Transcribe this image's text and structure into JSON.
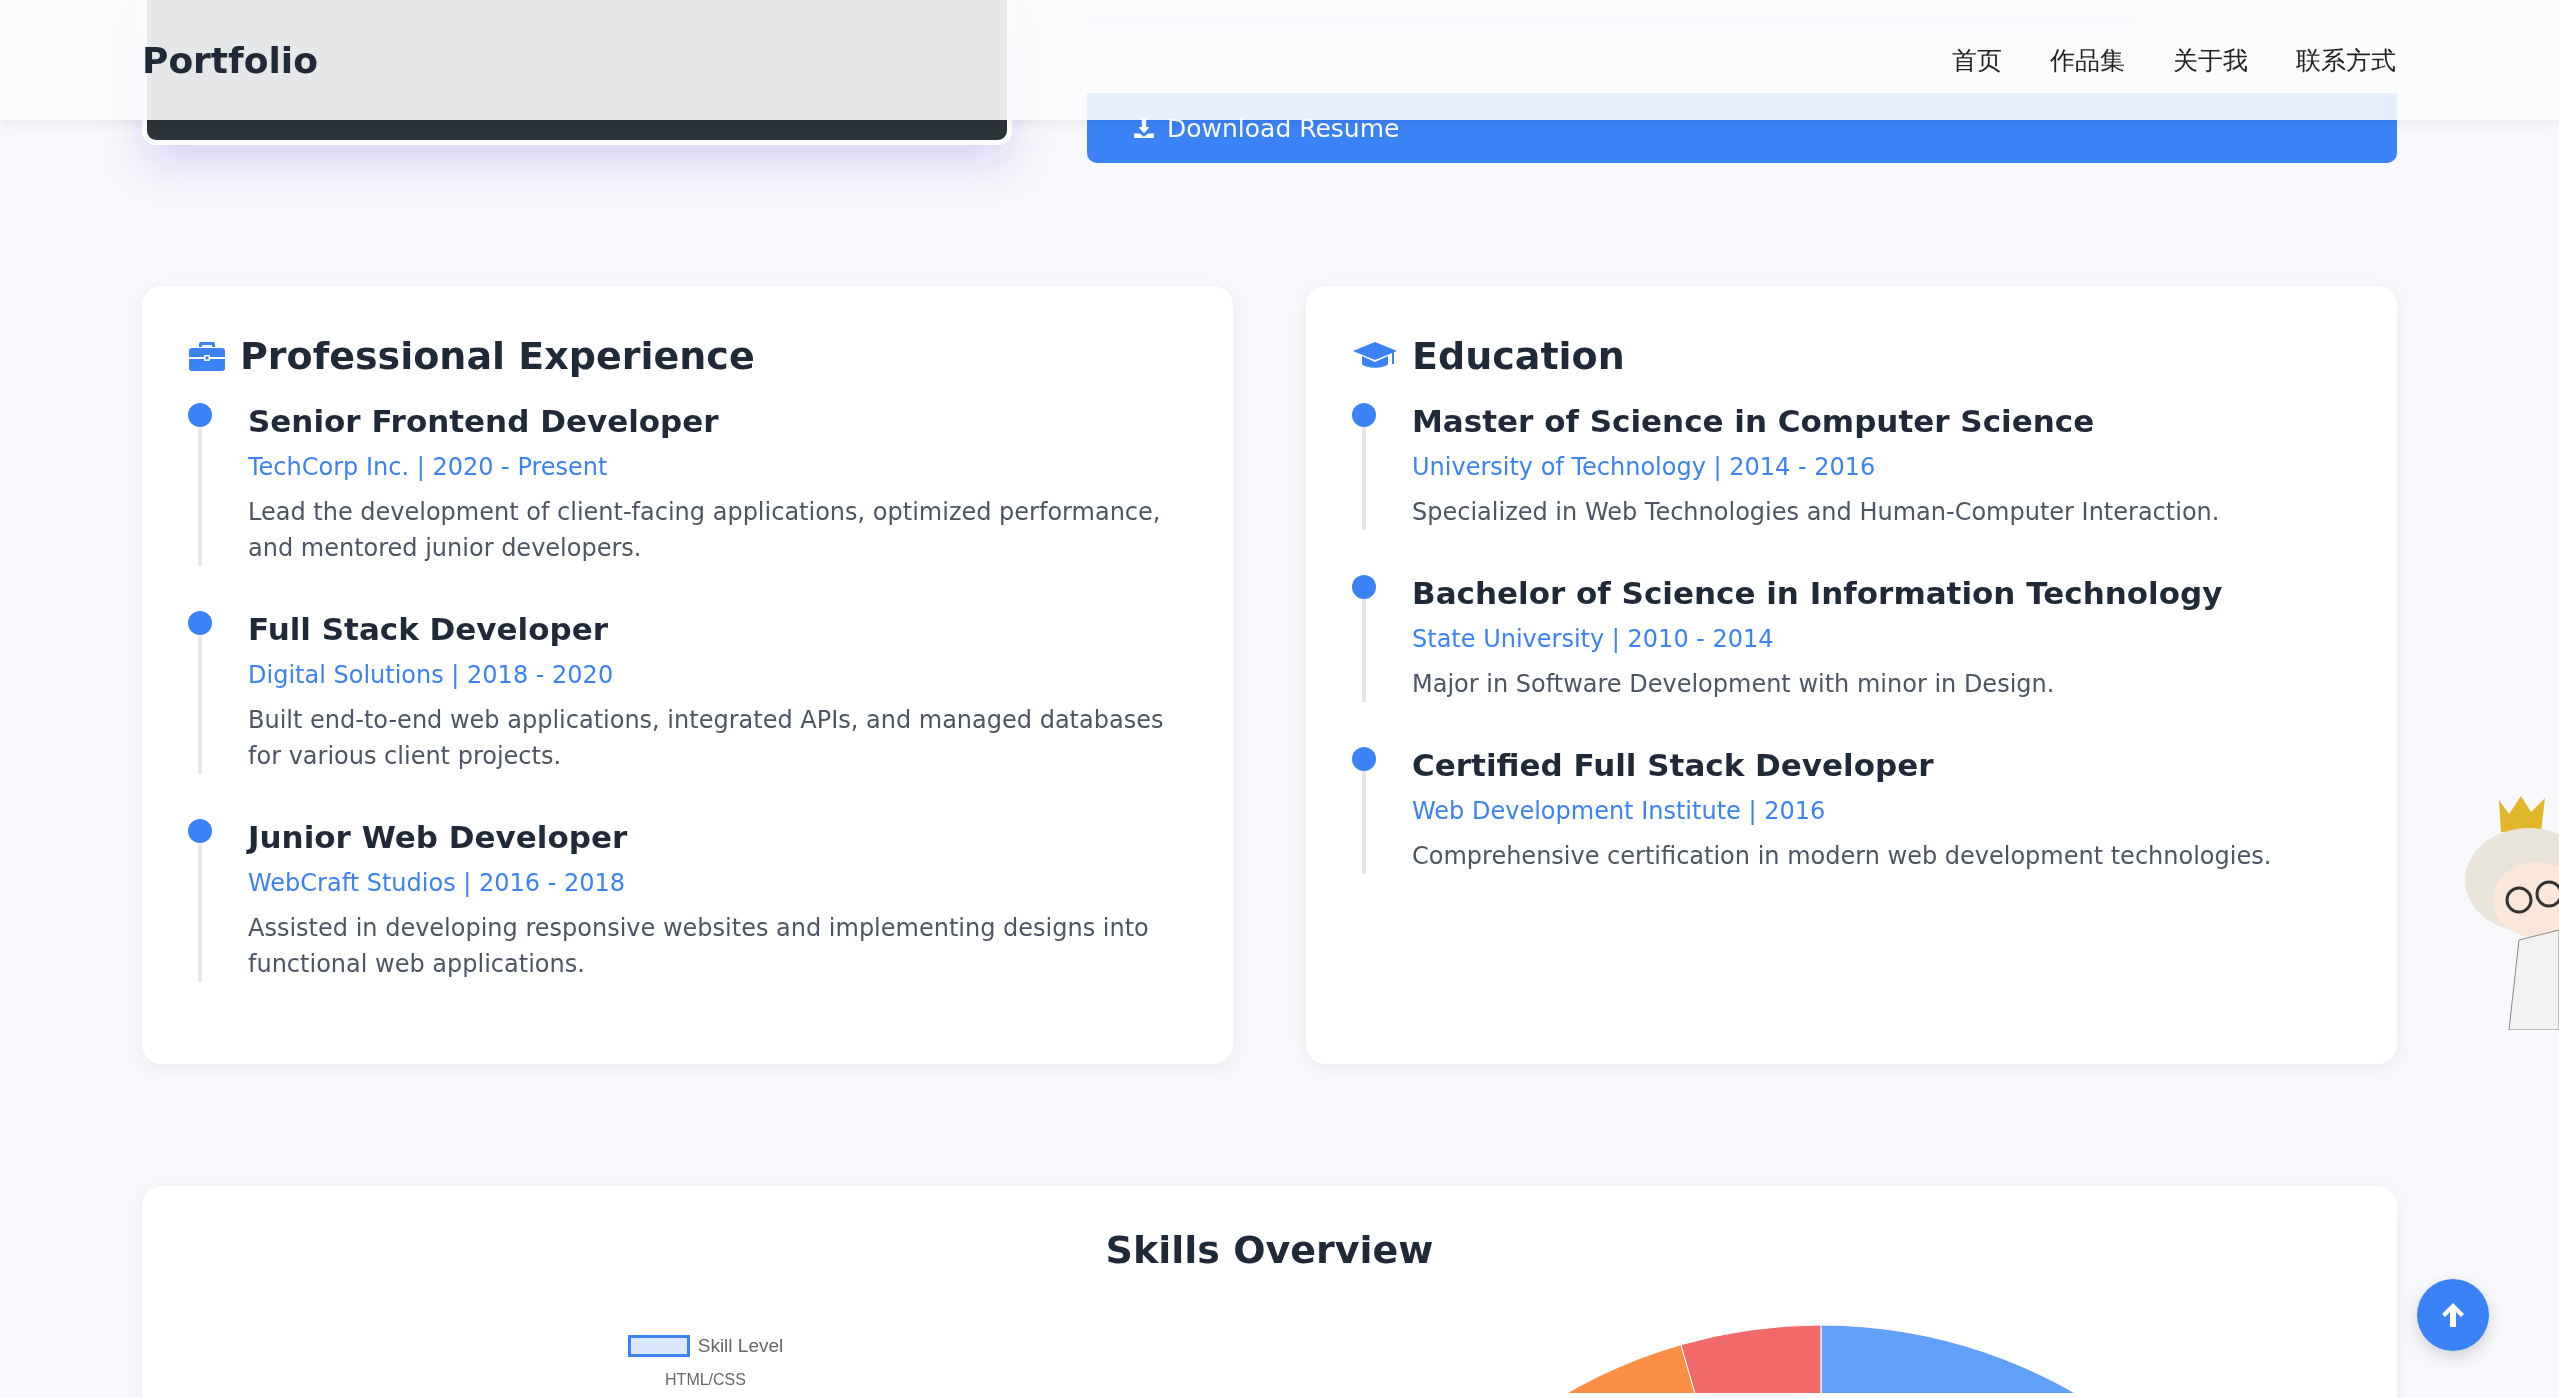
{
  "header": {
    "logo": "Portfolio",
    "nav": [
      {
        "label": "首页"
      },
      {
        "label": "作品集"
      },
      {
        "label": "关于我"
      },
      {
        "label": "联系方式"
      }
    ]
  },
  "hero": {
    "button": "Download Resume"
  },
  "experience": {
    "title": "Professional Experience",
    "items": [
      {
        "title": "Senior Frontend Developer",
        "subtitle": "TechCorp Inc. | 2020 - Present",
        "description": "Lead the development of client-facing applications, optimized performance, and mentored junior developers."
      },
      {
        "title": "Full Stack Developer",
        "subtitle": "Digital Solutions | 2018 - 2020",
        "description": "Built end-to-end web applications, integrated APIs, and managed databases for various client projects."
      },
      {
        "title": "Junior Web Developer",
        "subtitle": "WebCraft Studios | 2016 - 2018",
        "description": "Assisted in developing responsive websites and implementing designs into functional web applications."
      }
    ]
  },
  "education": {
    "title": "Education",
    "items": [
      {
        "title": "Master of Science in Computer Science",
        "subtitle": "University of Technology | 2014 - 2016",
        "description": "Specialized in Web Technologies and Human-Computer Interaction."
      },
      {
        "title": "Bachelor of Science in Information Technology",
        "subtitle": "State University | 2010 - 2014",
        "description": "Major in Software Development with minor in Design."
      },
      {
        "title": "Certified Full Stack Developer",
        "subtitle": "Web Development Institute | 2016",
        "description": "Comprehensive certification in modern web development technologies."
      }
    ]
  },
  "skills": {
    "title": "Skills Overview",
    "legend": "Skill Level",
    "category": "HTML/CSS"
  }
}
